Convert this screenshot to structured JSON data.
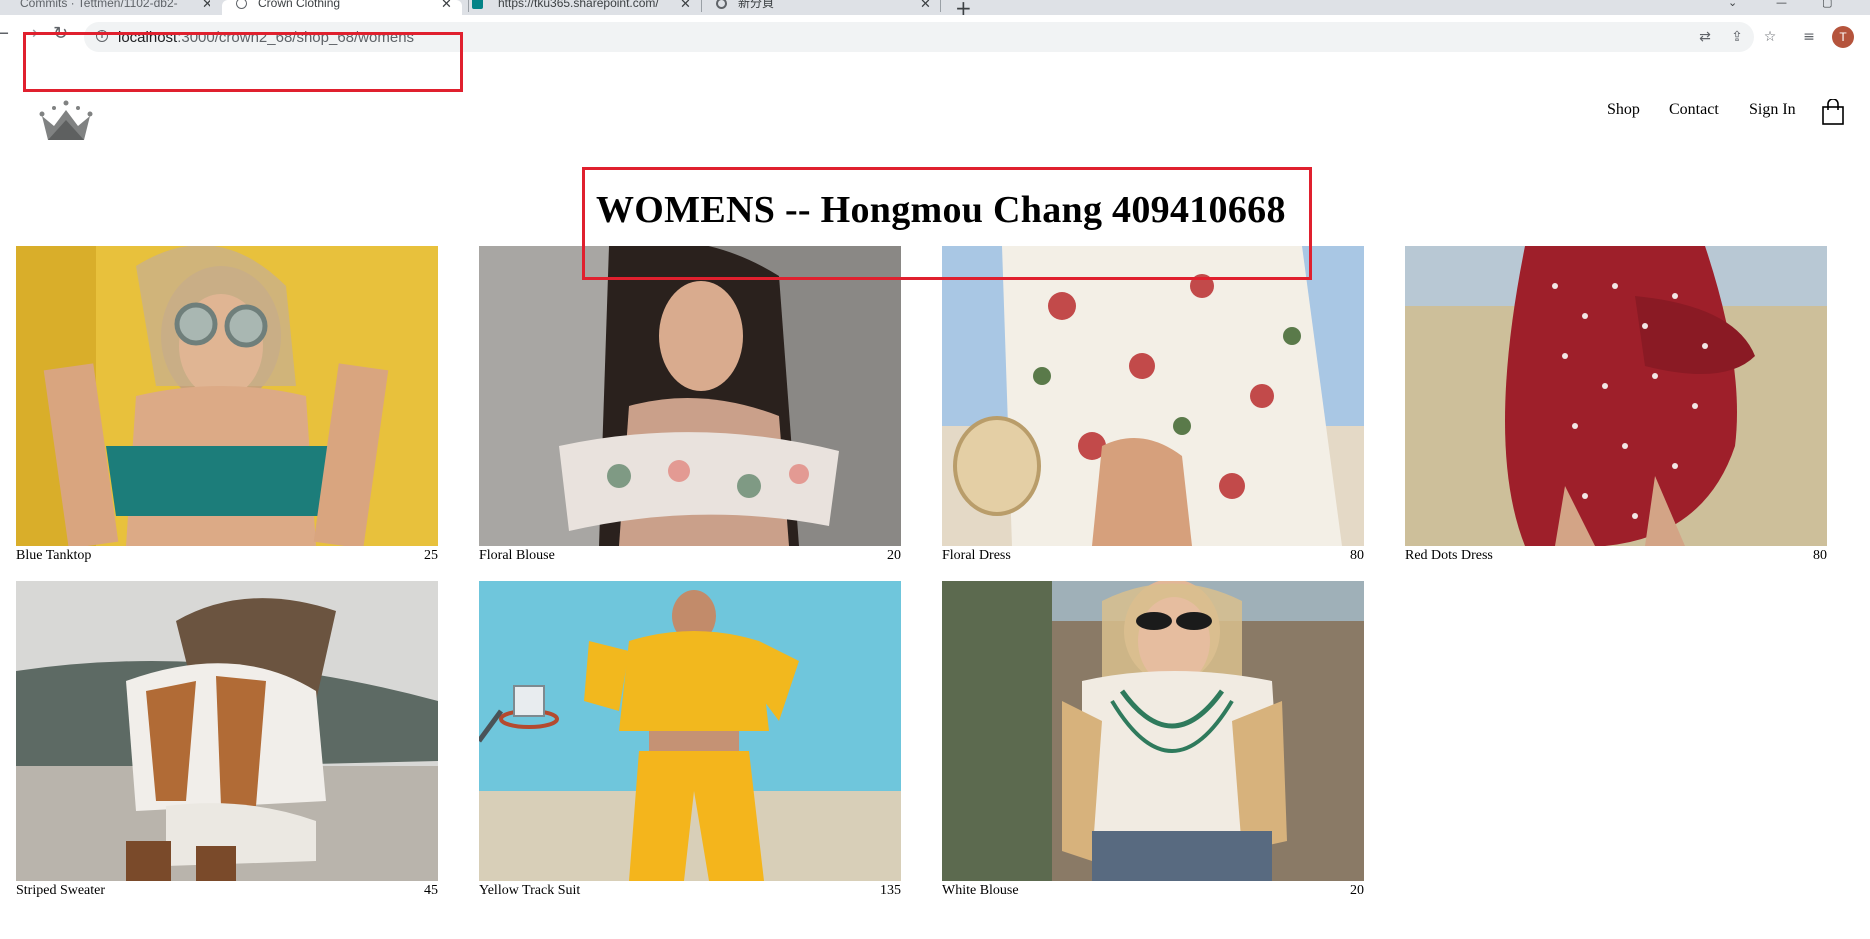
{
  "browser": {
    "tabs": [
      {
        "title": "Commits · Tettmen/1102-db2-",
        "active": false
      },
      {
        "title": "Crown Clothing",
        "active": true
      },
      {
        "title": "https://tku365.sharepoint.com/",
        "active": false
      },
      {
        "title": "新分頁",
        "active": false
      }
    ],
    "new_tab_label": "+",
    "url_host": "localhost",
    "url_path": ":3000/crown2_68/shop_68/womens"
  },
  "header": {
    "logo_icon": "crown-logo-icon",
    "nav": {
      "shop": "Shop",
      "contact": "Contact",
      "sign_in": "Sign In"
    },
    "cart_icon": "shopping-bag-icon"
  },
  "page": {
    "title": "WOMENS -- Hongmou Chang 409410668"
  },
  "products": [
    {
      "name": "Blue Tanktop",
      "price": "25"
    },
    {
      "name": "Floral Blouse",
      "price": "20"
    },
    {
      "name": "Floral Dress",
      "price": "80"
    },
    {
      "name": "Red Dots Dress",
      "price": "80"
    },
    {
      "name": "Striped Sweater",
      "price": "45"
    },
    {
      "name": "Yellow Track Suit",
      "price": "135"
    },
    {
      "name": "White Blouse",
      "price": "20"
    }
  ],
  "profile_initial": "T",
  "colors": {
    "annotation_red": "#e0202e",
    "tabbar": "#dee1e6",
    "omnibox": "#f1f3f4"
  }
}
